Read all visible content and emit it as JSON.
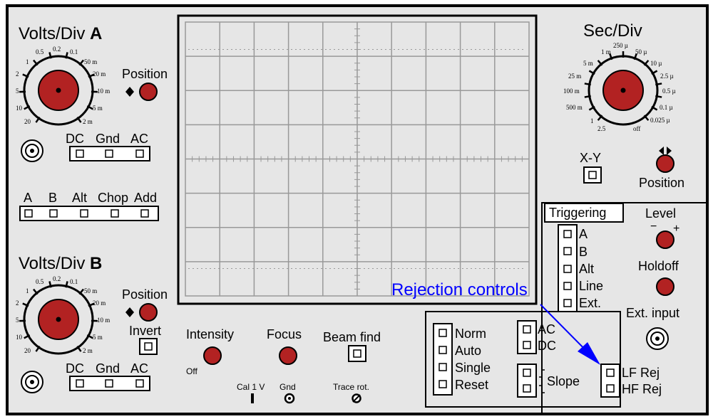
{
  "channel_a": {
    "title_prefix": "Volts/Div ",
    "title_letter": "A",
    "position_label": "Position",
    "coupling": [
      "DC",
      "Gnd",
      "AC"
    ],
    "dial_labels": [
      "0.5",
      "0.2",
      "0.1",
      "50 m",
      "20 m",
      "10 m",
      "5 m",
      "2 m",
      "20",
      "10",
      "5",
      "2",
      "1"
    ]
  },
  "mode": {
    "labels": [
      "A",
      "B",
      "Alt",
      "Chop",
      "Add"
    ]
  },
  "channel_b": {
    "title_prefix": "Volts/Div ",
    "title_letter": "B",
    "position_label": "Position",
    "invert_label": "Invert",
    "coupling": [
      "DC",
      "Gnd",
      "AC"
    ],
    "dial_labels": [
      "0.5",
      "0.2",
      "0.1",
      "50 m",
      "20 m",
      "10 m",
      "5 m",
      "2 m",
      "20",
      "10",
      "5",
      "2",
      "1"
    ]
  },
  "timebase": {
    "title": "Sec/Div",
    "dial_labels": [
      "250 µ",
      "1 m",
      "50 µ",
      "5 m",
      "10 µ",
      "25 m",
      "2.5 µ",
      "100 m",
      "0.5 µ",
      "500 m",
      "0.1 µ",
      "1",
      "0.025 µ",
      "2.5",
      "off"
    ],
    "xy_label": "X-Y",
    "position_label": "Position"
  },
  "triggering": {
    "title": "Triggering",
    "sources": [
      "A",
      "B",
      "Alt",
      "Line",
      "Ext."
    ],
    "level_label": "Level",
    "level_minus": "−",
    "level_plus": "+",
    "holdoff_label": "Holdoff",
    "ext_input_label": "Ext. input"
  },
  "sweep": {
    "modes": [
      "Norm",
      "Auto",
      "Single",
      "Reset"
    ],
    "coupling": [
      "AC",
      "DC"
    ],
    "slope_label": "Slope",
    "rejection": [
      "LF Rej",
      "HF Rej"
    ]
  },
  "display": {
    "intensity_label": "Intensity",
    "intensity_off": "Off",
    "focus_label": "Focus",
    "beam_find_label": "Beam find",
    "cal_label": "Cal  1  V",
    "gnd_label": "Gnd",
    "trace_rot_label": "Trace rot."
  },
  "annotation": {
    "text": "Rejection controls",
    "color": "#0000ff"
  },
  "colors": {
    "panel": "#e6e6e6",
    "knob": "#b22222",
    "outline": "#000000",
    "grid": "#999999"
  }
}
